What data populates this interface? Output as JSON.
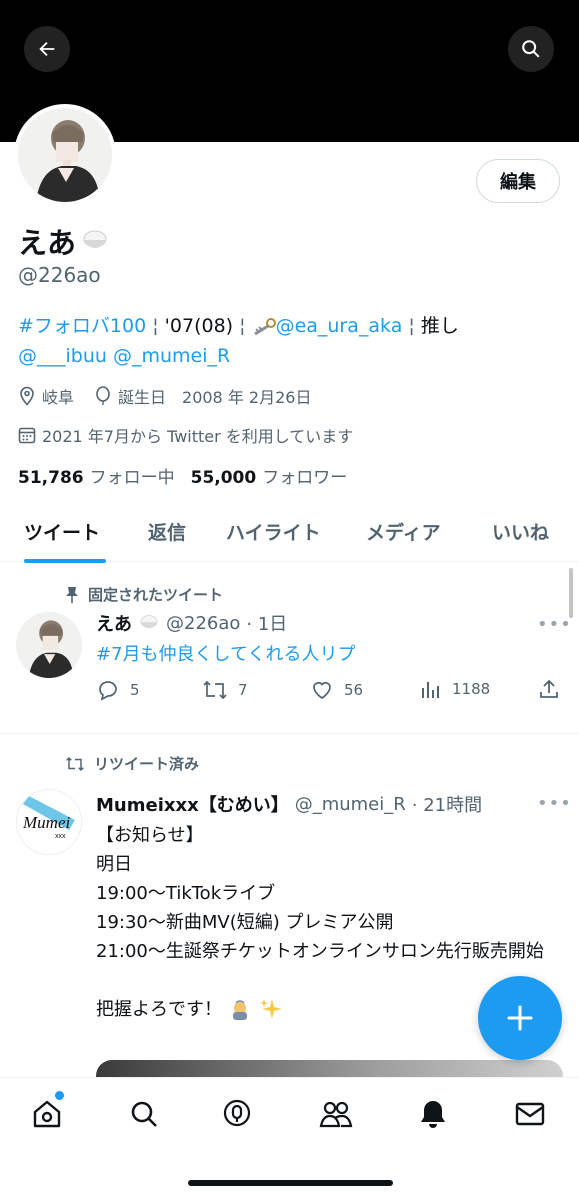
{
  "header": {
    "back_icon": "back-arrow-icon",
    "search_icon": "search-icon"
  },
  "profile": {
    "name": "えあ",
    "name_emoji": "rice-bowl-icon",
    "handle": "@226ao",
    "edit_label": "編集",
    "bio": {
      "hashtag": "#フォロバ100",
      "sep1": " ¦ ",
      "year": "'07(08)",
      "sep2": " ¦ ",
      "key_emoji": "key-icon",
      "mention1": "@ea_ura_aka",
      "sep3": " ¦ ",
      "oshi": "推し",
      "mention2": "@___ibuu",
      "mention3": "@_mumei_R"
    },
    "location": "岐阜",
    "birthday": "誕生日　2008 年 2月26日",
    "joined": "2021 年7月から Twitter を利用しています",
    "following_count": "51,786",
    "following_label": "フォロー中",
    "followers_count": "55,000",
    "followers_label": "フォロワー"
  },
  "tabs": [
    "ツイート",
    "返信",
    "ハイライト",
    "メディア",
    "いいね"
  ],
  "active_tab": 0,
  "tweet1": {
    "context": "固定されたツイート",
    "name": "えあ",
    "handle": "@226ao",
    "time": "· 1日",
    "text": "#7月も仲良くしてくれる人リプ",
    "replies": "5",
    "retweets": "7",
    "likes": "56",
    "views": "1188"
  },
  "tweet2": {
    "context": "リツイート済み",
    "name": "Mumeixxx【むめい】",
    "handle": "@_mumei_R",
    "time": "· 21時間",
    "lines": [
      "【お知らせ】",
      "明日",
      "19:00～TikTokライブ",
      "19:30～新曲MV(短編) プレミア公開",
      "21:00～生誕祭チケットオンラインサロン先行販売開始",
      "",
      "把握よろです！"
    ],
    "emoji": "sparkles-icon"
  },
  "fab_label": "+",
  "colors": {
    "accent": "#1d9bf0",
    "text": "#0f1419",
    "muted": "#536471"
  }
}
